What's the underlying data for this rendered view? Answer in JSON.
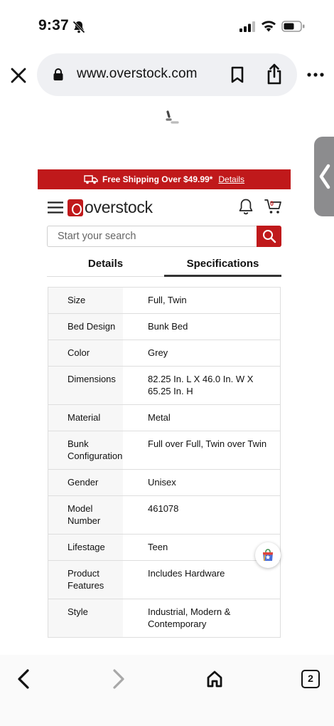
{
  "status_bar": {
    "time": "9:37"
  },
  "browser": {
    "url": "www.overstock.com",
    "open_tabs": "2"
  },
  "banner": {
    "text": "Free Shipping Over $49.99*",
    "link": "Details"
  },
  "header": {
    "logo_text": "overstock",
    "cart_count": "0"
  },
  "search": {
    "placeholder": "Start your search"
  },
  "tabs": [
    {
      "label": "Details",
      "active": false
    },
    {
      "label": "Specifications",
      "active": true
    }
  ],
  "specs": [
    {
      "key": "Size",
      "value": "Full, Twin"
    },
    {
      "key": "Bed Design",
      "value": "Bunk Bed"
    },
    {
      "key": "Color",
      "value": "Grey"
    },
    {
      "key": "Dimensions",
      "value": "82.25 In. L X 46.0 In. W X 65.25 In. H"
    },
    {
      "key": "Material",
      "value": "Metal"
    },
    {
      "key": "Bunk Configuration",
      "value": "Full over Full, Twin over Twin"
    },
    {
      "key": "Gender",
      "value": "Unisex"
    },
    {
      "key": "Model Number",
      "value": "461078"
    },
    {
      "key": "Lifestage",
      "value": "Teen"
    },
    {
      "key": "Product Features",
      "value": "Includes Hardware"
    },
    {
      "key": "Style",
      "value": "Industrial, Modern & Contemporary"
    }
  ],
  "colors": {
    "brand_red": "#c0191b",
    "url_pill": "#eff0f3"
  }
}
